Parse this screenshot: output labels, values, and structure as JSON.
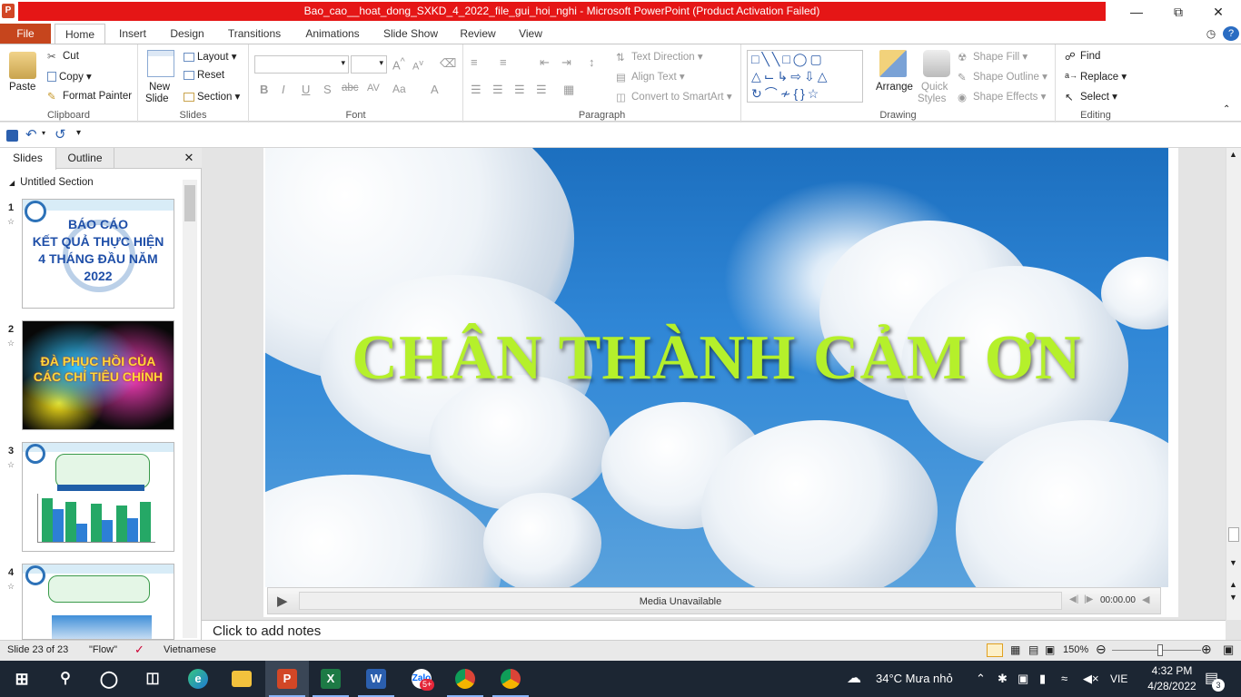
{
  "window": {
    "title": "Bao_cao__hoat_dong_SXKD_4_2022_file_gui_hoi_nghi - Microsoft PowerPoint (Product Activation Failed)",
    "app_logo": "P"
  },
  "tabs": [
    "File",
    "Home",
    "Insert",
    "Design",
    "Transitions",
    "Animations",
    "Slide Show",
    "Review",
    "View"
  ],
  "clipboard": {
    "paste": "Paste",
    "cut": "Cut",
    "copy": "Copy",
    "format_painter": "Format Painter",
    "label": "Clipboard"
  },
  "slides_group": {
    "new_slide": "New",
    "new_slide2": "Slide",
    "layout": "Layout",
    "reset": "Reset",
    "section": "Section",
    "label": "Slides"
  },
  "font_group": {
    "label": "Font"
  },
  "paragraph_group": {
    "text_direction": "Text Direction",
    "align_text": "Align Text",
    "convert": "Convert to SmartArt",
    "label": "Paragraph"
  },
  "drawing_group": {
    "arrange": "Arrange",
    "quick": "Quick",
    "styles": "Styles",
    "shape_fill": "Shape Fill",
    "shape_outline": "Shape Outline",
    "shape_effects": "Shape Effects",
    "label": "Drawing"
  },
  "editing_group": {
    "find": "Find",
    "replace": "Replace",
    "select": "Select",
    "label": "Editing"
  },
  "pane": {
    "tab_slides": "Slides",
    "tab_outline": "Outline",
    "section": "Untitled Section"
  },
  "thumbs": [
    {
      "num": "1",
      "title": "BÁO CÁO\nKẾT QUẢ THỰC HIỆN\n4 THÁNG ĐẦU NĂM\n2022"
    },
    {
      "num": "2",
      "title": "ĐÀ PHỤC HỒI CỦA\nCÁC CHỈ TIÊU CHÍNH"
    },
    {
      "num": "3"
    },
    {
      "num": "4"
    }
  ],
  "slide": {
    "thanks": "CHÂN THÀNH CẢM ƠN",
    "media_status": "Media Unavailable",
    "media_time": "00:00.00"
  },
  "notes": {
    "placeholder": "Click to add notes"
  },
  "status": {
    "slide_info": "Slide 23 of 23",
    "theme": "\"Flow\"",
    "language": "Vietnamese",
    "zoom": "150%"
  },
  "taskbar": {
    "weather": "34°C  Mưa nhỏ",
    "lang": "VIE",
    "time": "4:32 PM",
    "date": "4/28/2022",
    "notif": "3",
    "zalo_badge": "5+"
  }
}
